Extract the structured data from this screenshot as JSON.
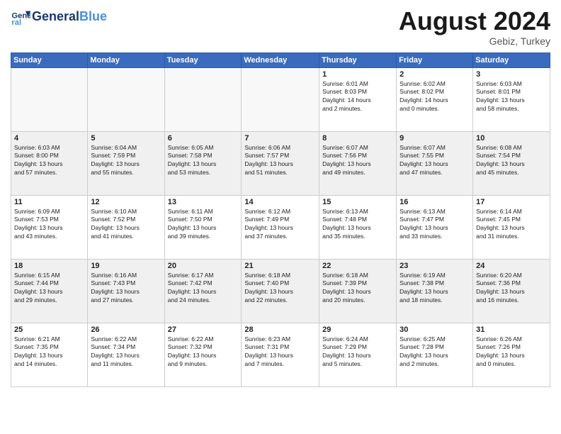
{
  "header": {
    "logo_general": "General",
    "logo_blue": "Blue",
    "month": "August 2024",
    "location": "Gebiz, Turkey"
  },
  "weekdays": [
    "Sunday",
    "Monday",
    "Tuesday",
    "Wednesday",
    "Thursday",
    "Friday",
    "Saturday"
  ],
  "days": [
    {
      "num": "",
      "info": "",
      "empty": true
    },
    {
      "num": "",
      "info": "",
      "empty": true
    },
    {
      "num": "",
      "info": "",
      "empty": true
    },
    {
      "num": "",
      "info": "",
      "empty": true
    },
    {
      "num": "1",
      "info": "Sunrise: 6:01 AM\nSunset: 8:03 PM\nDaylight: 14 hours\nand 2 minutes."
    },
    {
      "num": "2",
      "info": "Sunrise: 6:02 AM\nSunset: 8:02 PM\nDaylight: 14 hours\nand 0 minutes."
    },
    {
      "num": "3",
      "info": "Sunrise: 6:03 AM\nSunset: 8:01 PM\nDaylight: 13 hours\nand 58 minutes."
    },
    {
      "num": "4",
      "info": "Sunrise: 6:03 AM\nSunset: 8:00 PM\nDaylight: 13 hours\nand 57 minutes."
    },
    {
      "num": "5",
      "info": "Sunrise: 6:04 AM\nSunset: 7:59 PM\nDaylight: 13 hours\nand 55 minutes."
    },
    {
      "num": "6",
      "info": "Sunrise: 6:05 AM\nSunset: 7:58 PM\nDaylight: 13 hours\nand 53 minutes."
    },
    {
      "num": "7",
      "info": "Sunrise: 6:06 AM\nSunset: 7:57 PM\nDaylight: 13 hours\nand 51 minutes."
    },
    {
      "num": "8",
      "info": "Sunrise: 6:07 AM\nSunset: 7:56 PM\nDaylight: 13 hours\nand 49 minutes."
    },
    {
      "num": "9",
      "info": "Sunrise: 6:07 AM\nSunset: 7:55 PM\nDaylight: 13 hours\nand 47 minutes."
    },
    {
      "num": "10",
      "info": "Sunrise: 6:08 AM\nSunset: 7:54 PM\nDaylight: 13 hours\nand 45 minutes."
    },
    {
      "num": "11",
      "info": "Sunrise: 6:09 AM\nSunset: 7:53 PM\nDaylight: 13 hours\nand 43 minutes."
    },
    {
      "num": "12",
      "info": "Sunrise: 6:10 AM\nSunset: 7:52 PM\nDaylight: 13 hours\nand 41 minutes."
    },
    {
      "num": "13",
      "info": "Sunrise: 6:11 AM\nSunset: 7:50 PM\nDaylight: 13 hours\nand 39 minutes."
    },
    {
      "num": "14",
      "info": "Sunrise: 6:12 AM\nSunset: 7:49 PM\nDaylight: 13 hours\nand 37 minutes."
    },
    {
      "num": "15",
      "info": "Sunrise: 6:13 AM\nSunset: 7:48 PM\nDaylight: 13 hours\nand 35 minutes."
    },
    {
      "num": "16",
      "info": "Sunrise: 6:13 AM\nSunset: 7:47 PM\nDaylight: 13 hours\nand 33 minutes."
    },
    {
      "num": "17",
      "info": "Sunrise: 6:14 AM\nSunset: 7:45 PM\nDaylight: 13 hours\nand 31 minutes."
    },
    {
      "num": "18",
      "info": "Sunrise: 6:15 AM\nSunset: 7:44 PM\nDaylight: 13 hours\nand 29 minutes."
    },
    {
      "num": "19",
      "info": "Sunrise: 6:16 AM\nSunset: 7:43 PM\nDaylight: 13 hours\nand 27 minutes."
    },
    {
      "num": "20",
      "info": "Sunrise: 6:17 AM\nSunset: 7:42 PM\nDaylight: 13 hours\nand 24 minutes."
    },
    {
      "num": "21",
      "info": "Sunrise: 6:18 AM\nSunset: 7:40 PM\nDaylight: 13 hours\nand 22 minutes."
    },
    {
      "num": "22",
      "info": "Sunrise: 6:18 AM\nSunset: 7:39 PM\nDaylight: 13 hours\nand 20 minutes."
    },
    {
      "num": "23",
      "info": "Sunrise: 6:19 AM\nSunset: 7:38 PM\nDaylight: 13 hours\nand 18 minutes."
    },
    {
      "num": "24",
      "info": "Sunrise: 6:20 AM\nSunset: 7:36 PM\nDaylight: 13 hours\nand 16 minutes."
    },
    {
      "num": "25",
      "info": "Sunrise: 6:21 AM\nSunset: 7:35 PM\nDaylight: 13 hours\nand 14 minutes."
    },
    {
      "num": "26",
      "info": "Sunrise: 6:22 AM\nSunset: 7:34 PM\nDaylight: 13 hours\nand 11 minutes."
    },
    {
      "num": "27",
      "info": "Sunrise: 6:22 AM\nSunset: 7:32 PM\nDaylight: 13 hours\nand 9 minutes."
    },
    {
      "num": "28",
      "info": "Sunrise: 6:23 AM\nSunset: 7:31 PM\nDaylight: 13 hours\nand 7 minutes."
    },
    {
      "num": "29",
      "info": "Sunrise: 6:24 AM\nSunset: 7:29 PM\nDaylight: 13 hours\nand 5 minutes."
    },
    {
      "num": "30",
      "info": "Sunrise: 6:25 AM\nSunset: 7:28 PM\nDaylight: 13 hours\nand 2 minutes."
    },
    {
      "num": "31",
      "info": "Sunrise: 6:26 AM\nSunset: 7:26 PM\nDaylight: 13 hours\nand 0 minutes."
    }
  ]
}
